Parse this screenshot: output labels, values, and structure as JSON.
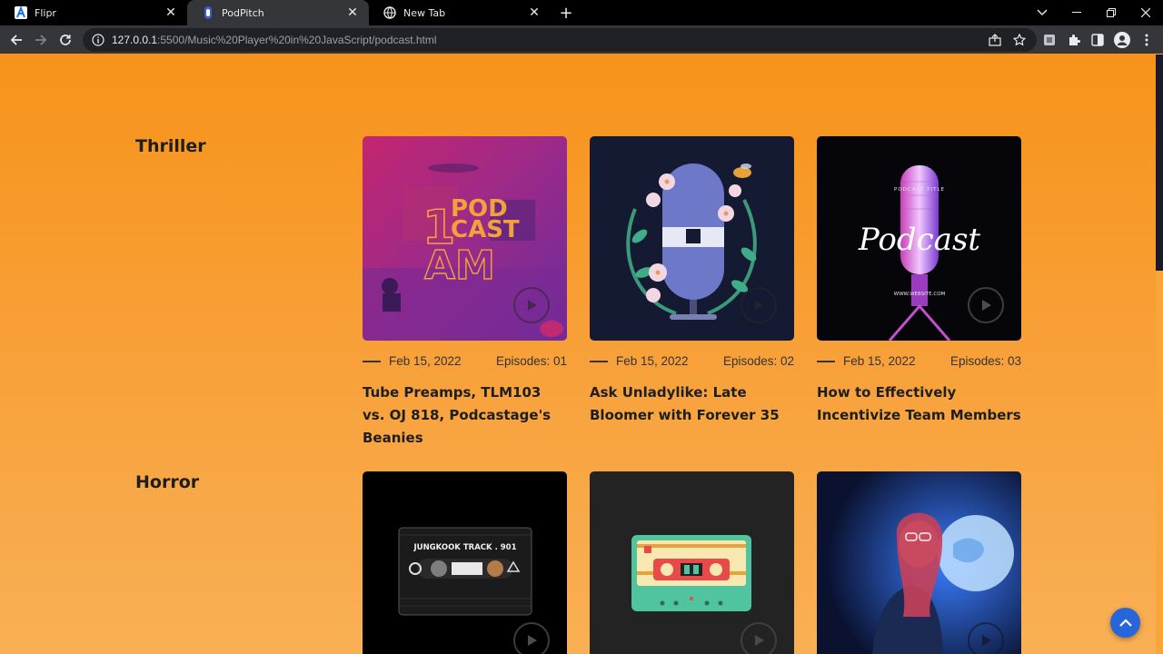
{
  "browser": {
    "tabs": [
      {
        "title": "Flipr",
        "favicon": "flipr-logo-icon",
        "active": false
      },
      {
        "title": "PodPitch",
        "favicon": "podpitch-logo-icon",
        "active": true
      },
      {
        "title": "New Tab",
        "favicon": "globe-icon",
        "active": false
      }
    ],
    "url_host": "127.0.0.1",
    "url_rest": ":5500/Music%20Player%20in%20JavaScript/podcast.html"
  },
  "categories": [
    {
      "name": "Thriller",
      "cards": [
        {
          "date": "Feb 15, 2022",
          "episodes": "Episodes: 01",
          "title": "Tube Preamps, TLM103 vs. OJ 818, Podcastage's Beanies",
          "art_text_1": "1",
          "art_text_2": "POD",
          "art_text_3": "CAST",
          "art_text_4": "AM"
        },
        {
          "date": "Feb 15, 2022",
          "episodes": "Episodes: 02",
          "title": "Ask Unladylike: Late Bloomer with Forever 35"
        },
        {
          "date": "Feb 15, 2022",
          "episodes": "Episodes: 03",
          "title": "How to Effectively Incentivize Team Members",
          "art_text_1": "Podcast",
          "art_text_2": "PODCAST TITLE",
          "art_text_3": "WWW.WEBSITE.COM"
        }
      ]
    },
    {
      "name": "Horror",
      "cards": [
        {
          "art_text_1": "JUNGKOOK TRACK . 901"
        },
        {},
        {}
      ]
    }
  ],
  "colors": {
    "page_top": "#f7931a",
    "page_bottom": "#f9b055",
    "back_to_top": "#2766d8"
  }
}
